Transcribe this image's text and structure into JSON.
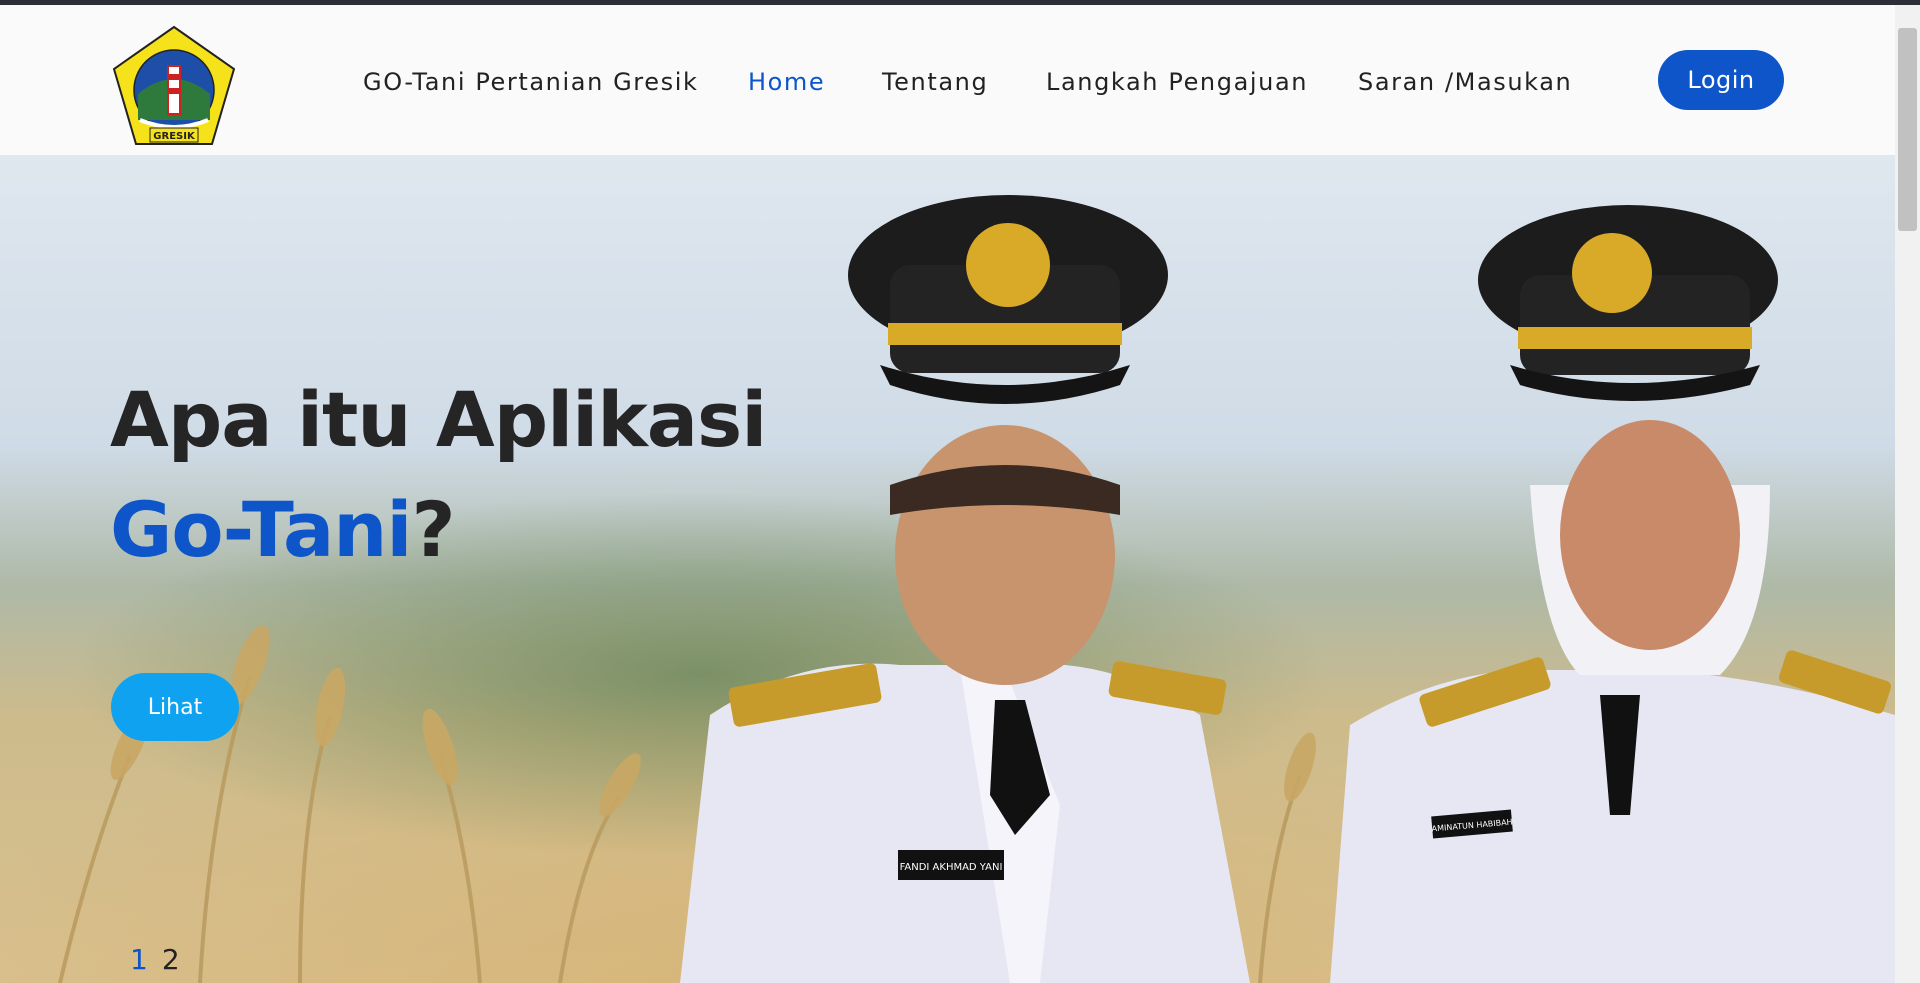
{
  "header": {
    "logo_name": "gresik-regency-emblem",
    "logo_text": "GRESIK",
    "nav": [
      {
        "label": "GO-Tani Pertanian Gresik",
        "active": false
      },
      {
        "label": "Home",
        "active": true
      },
      {
        "label": "Tentang",
        "active": false
      },
      {
        "label": "Langkah Pengajuan",
        "active": false
      },
      {
        "label": "Saran /Masukan",
        "active": false
      }
    ],
    "login_label": "Login"
  },
  "hero": {
    "title_part1": "Apa itu Aplikasi ",
    "title_accent": "Go-Tani",
    "title_end": "?",
    "cta_label": "Lihat",
    "nameplate_left": "FANDI AKHMAD YANI",
    "nameplate_right": "AMINATUN HABIBAH",
    "pager": [
      "1",
      "2"
    ],
    "active_page": "1"
  },
  "colors": {
    "accent": "#0d55c9",
    "cta": "#0ea2f0",
    "text": "#252525"
  }
}
